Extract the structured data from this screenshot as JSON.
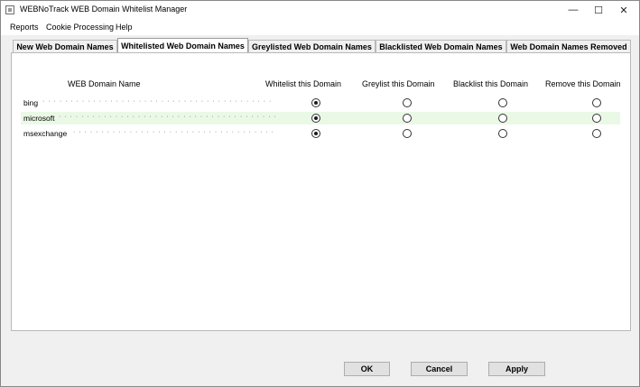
{
  "window": {
    "title": "WEBNoTrack WEB Domain Whitelist Manager",
    "controls": {
      "minimize": "—",
      "maximize": "☐",
      "close": "✕"
    }
  },
  "menu": [
    "Reports",
    "Cookie Processing",
    "Help"
  ],
  "tabs": [
    {
      "label": "New Web Domain Names",
      "active": false
    },
    {
      "label": "Whitelisted Web Domain Names",
      "active": true
    },
    {
      "label": "Greylisted Web Domain Names",
      "active": false
    },
    {
      "label": "Blacklisted Web Domain Names",
      "active": false
    },
    {
      "label": "Web Domain Names Removed",
      "active": false
    }
  ],
  "table": {
    "headers": {
      "name": "WEB Domain Name",
      "whitelist": "Whitelist this Domain",
      "greylist": "Greylist this Domain",
      "blacklist": "Blacklist this Domain",
      "remove": "Remove this Domain"
    },
    "rows": [
      {
        "name": "bing",
        "selected": "whitelist",
        "highlight": false
      },
      {
        "name": "microsoft",
        "selected": "whitelist",
        "highlight": true
      },
      {
        "name": "msexchange",
        "selected": "whitelist",
        "highlight": false
      }
    ],
    "highlight_color": "#eaf9e6"
  },
  "buttons": {
    "ok": "OK",
    "cancel": "Cancel",
    "apply": "Apply"
  }
}
